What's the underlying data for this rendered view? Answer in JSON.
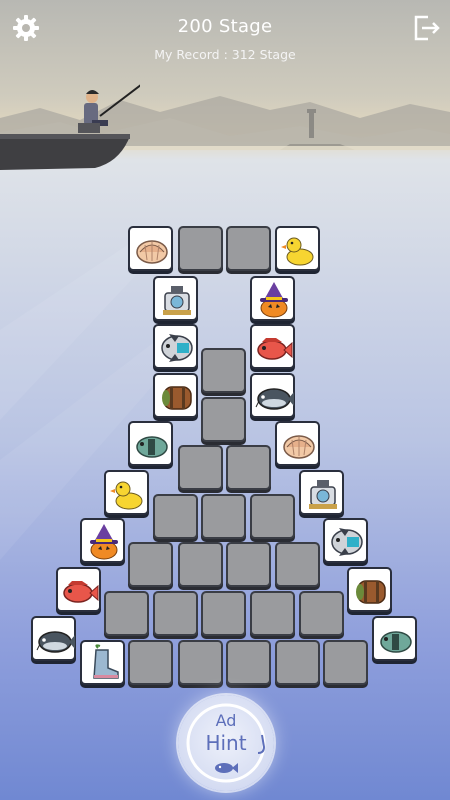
{
  "header": {
    "stage_title": "200 Stage",
    "record_text": "My Record : 312 Stage",
    "settings_icon": "gear-icon",
    "exit_icon": "exit-icon"
  },
  "hint_button": {
    "ad_label": "Ad",
    "label": "Hint",
    "icon": "fish-icon"
  },
  "board": {
    "tiles": [
      {
        "kind": "shell",
        "state": "open"
      },
      {
        "kind": "blank",
        "state": "blocked"
      },
      {
        "kind": "blank",
        "state": "blocked"
      },
      {
        "kind": "duck",
        "state": "open"
      },
      {
        "kind": "diver",
        "state": "open"
      },
      {
        "kind": "witch-pumpkin",
        "state": "open"
      },
      {
        "kind": "sunfish",
        "state": "open"
      },
      {
        "kind": "red-snapper",
        "state": "open"
      },
      {
        "kind": "blank",
        "state": "blocked"
      },
      {
        "kind": "barrel",
        "state": "open"
      },
      {
        "kind": "catfish",
        "state": "open"
      },
      {
        "kind": "blank",
        "state": "blocked"
      },
      {
        "kind": "green-fish",
        "state": "open"
      },
      {
        "kind": "shell",
        "state": "open"
      },
      {
        "kind": "blank",
        "state": "blocked"
      },
      {
        "kind": "blank",
        "state": "blocked"
      },
      {
        "kind": "duck",
        "state": "open"
      },
      {
        "kind": "diver",
        "state": "open"
      },
      {
        "kind": "blank",
        "state": "blocked"
      },
      {
        "kind": "blank",
        "state": "blocked"
      },
      {
        "kind": "blank",
        "state": "blocked"
      },
      {
        "kind": "witch-pumpkin",
        "state": "open"
      },
      {
        "kind": "sunfish",
        "state": "open"
      },
      {
        "kind": "blank",
        "state": "blocked"
      },
      {
        "kind": "blank",
        "state": "blocked"
      },
      {
        "kind": "blank",
        "state": "blocked"
      },
      {
        "kind": "blank",
        "state": "blocked"
      },
      {
        "kind": "red-snapper",
        "state": "open"
      },
      {
        "kind": "barrel",
        "state": "open"
      },
      {
        "kind": "blank",
        "state": "blocked"
      },
      {
        "kind": "blank",
        "state": "blocked"
      },
      {
        "kind": "blank",
        "state": "blocked"
      },
      {
        "kind": "blank",
        "state": "blocked"
      },
      {
        "kind": "blank",
        "state": "blocked"
      },
      {
        "kind": "catfish",
        "state": "open"
      },
      {
        "kind": "green-fish",
        "state": "open"
      },
      {
        "kind": "boot",
        "state": "open"
      },
      {
        "kind": "blank",
        "state": "blocked"
      },
      {
        "kind": "blank",
        "state": "blocked"
      },
      {
        "kind": "blank",
        "state": "blocked"
      },
      {
        "kind": "blank",
        "state": "blocked"
      },
      {
        "kind": "blank",
        "state": "blocked"
      }
    ]
  },
  "colors": {
    "water_top": "#dfe3e8",
    "water_bottom": "#7088d2",
    "hint_text": "#5d6fba",
    "tile_open": "#ffffff",
    "tile_blocked": "#9a9b9e"
  }
}
